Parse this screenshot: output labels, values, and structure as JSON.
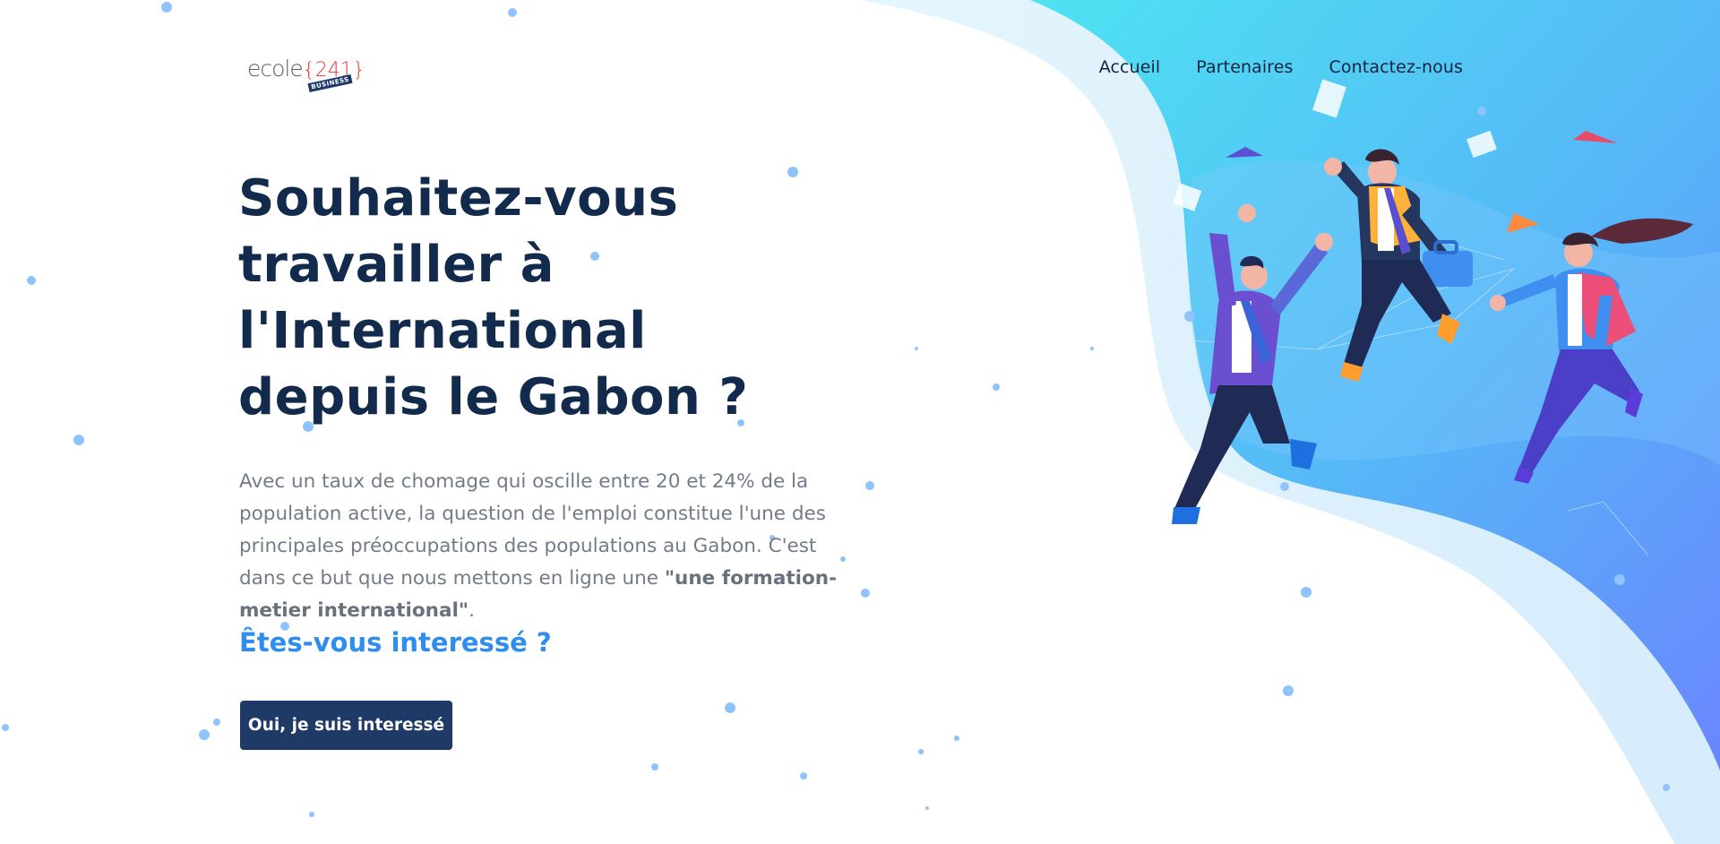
{
  "header": {
    "logo": {
      "word": "ecole",
      "number": "{241}",
      "tag": "BUSINESS"
    },
    "nav": [
      {
        "label": "Accueil"
      },
      {
        "label": "Partenaires"
      },
      {
        "label": "Contactez-nous"
      }
    ]
  },
  "hero": {
    "title": "Souhaitez-vous travailler à l'International depuis le Gabon ?",
    "text_before": "Avec un taux de chomage qui oscille entre 20 et 24% de la population active, la question de l'emploi constitue l'une des principales préoccupations des populations au Gabon. C'est dans ce but que nous mettons en ligne une ",
    "text_bold": "\"une formation-metier international\"",
    "text_after": ".",
    "question": "Êtes-vous interessé ?",
    "cta_label": "Oui, je suis interessé"
  },
  "colors": {
    "title": "#122a4c",
    "accent": "#2e8ef0",
    "button": "#1f3a66",
    "wave_start": "#4ee3f2",
    "wave_end": "#6a8cff"
  },
  "icons": [
    "logo-icon"
  ],
  "illustration": "three business people leaping joyfully"
}
